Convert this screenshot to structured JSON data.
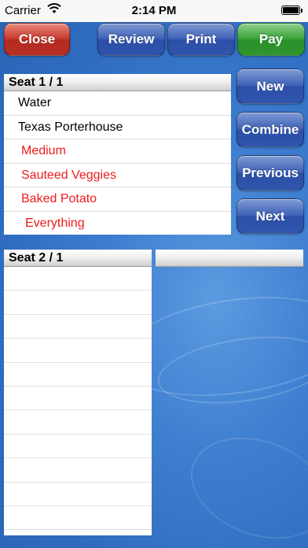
{
  "status_bar": {
    "carrier": "Carrier",
    "time": "2:14 PM",
    "wifi_icon": "wifi-icon",
    "battery_icon": "battery-icon",
    "battery_level": 1.0
  },
  "toolbar": {
    "close_label": "Close",
    "review_label": "Review",
    "print_label": "Print",
    "pay_label": "Pay"
  },
  "side_buttons": {
    "new_label": "New",
    "combine_label": "Combine",
    "previous_label": "Previous",
    "next_label": "Next"
  },
  "seat1": {
    "title": "Seat 1 / 1",
    "items": [
      {
        "label": "Water",
        "style": "item"
      },
      {
        "label": "Texas Porterhouse",
        "style": "item"
      },
      {
        "label": "Medium",
        "style": "modifier"
      },
      {
        "label": "Sauteed Veggies",
        "style": "modifier"
      },
      {
        "label": "Baked Potato",
        "style": "modifier"
      },
      {
        "label": "Everything",
        "style": "modifier-sub"
      }
    ]
  },
  "seat2": {
    "title": "Seat 2 / 1"
  },
  "seat3": {
    "title": ""
  },
  "colors": {
    "background": "#3f7fd0",
    "modifier_text": "#ee1c1c",
    "close_button": "#c8382c",
    "pay_button": "#3aa33a",
    "nav_button": "#3f62b8"
  }
}
